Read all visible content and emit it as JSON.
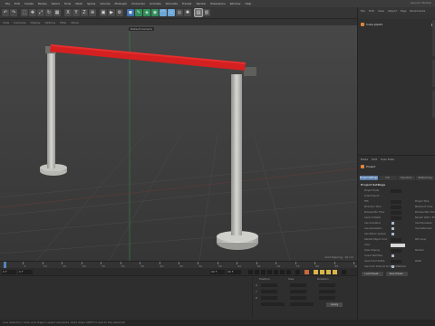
{
  "menu": [
    "File",
    "Edit",
    "Create",
    "Modes",
    "Select",
    "Tools",
    "Mesh",
    "Spline",
    "Volume",
    "MoGraph",
    "Character",
    "Animate",
    "Simulate",
    "Tracker",
    "Render",
    "Extensions",
    "Window",
    "Help"
  ],
  "layout_label": "Layout: Startup",
  "viewport": {
    "menu": [
      "View",
      "Cameras",
      "Display",
      "Options",
      "Filter",
      "Panel"
    ],
    "camera_label": "Default Camera",
    "grid_label": "Grid Spacing : 10 cm",
    "ribbon_color": "#d42020",
    "post_color": "#c9c9c5"
  },
  "timeline": {
    "ticks": [
      "0",
      "5",
      "10",
      "15",
      "20",
      "25",
      "30",
      "35",
      "40",
      "45",
      "50",
      "55",
      "60",
      "65",
      "70",
      "75",
      "80",
      "85",
      "90"
    ],
    "start_frame": "0 F",
    "end_frame": "90 F",
    "current_frame": "0 F",
    "range_end": "90 F"
  },
  "coords": {
    "headers": [
      "Position",
      "Size",
      "Rotation"
    ],
    "axes": [
      "X",
      "Y",
      "Z"
    ],
    "apply_label": "Apply"
  },
  "status": "Live Selection: Click and drag to select elements. Hold down SHIFT to add to the selection",
  "objects": {
    "menu": [
      "File",
      "Edit",
      "View",
      "Object",
      "Tags",
      "Bookmarks"
    ],
    "item_name": "Cube.plastic"
  },
  "attributes": {
    "menu": [
      "Mode",
      "Edit",
      "User Data"
    ],
    "object_label": "Project",
    "tabs": [
      "Project Settings",
      "Info",
      "Dynamics",
      "Referencing"
    ],
    "section": "Project Settings",
    "rows": [
      {
        "label": "Project Scale",
        "right": ""
      },
      {
        "label": "Scale Project...",
        "right": ""
      },
      {
        "label": "FPS",
        "right": "Project Time"
      },
      {
        "label": "Minimum Time",
        "right": "Maximum Time"
      },
      {
        "label": "Preview Min Time",
        "right": "Preview Max Time"
      },
      {
        "label": "Level of Detail",
        "right": "Render LOD in Editor"
      },
      {
        "label": "Use Animation",
        "right": "Use Expression"
      },
      {
        "label": "Use Generators",
        "right": "Use Deformers"
      },
      {
        "label": "Use Motion System",
        "right": ""
      },
      {
        "label": "Default Object Color",
        "right": "80% Gray"
      },
      {
        "label": "Color",
        "right": ""
      },
      {
        "label": "View Clipping",
        "right": "Medium"
      },
      {
        "label": "Linear Workflow",
        "right": ""
      },
      {
        "label": "Input Color Profile",
        "right": "sRGB"
      },
      {
        "label": "Use Color Channel for Node Material",
        "right": ""
      }
    ],
    "buttons": [
      "Load Preset...",
      "Save Preset..."
    ]
  }
}
